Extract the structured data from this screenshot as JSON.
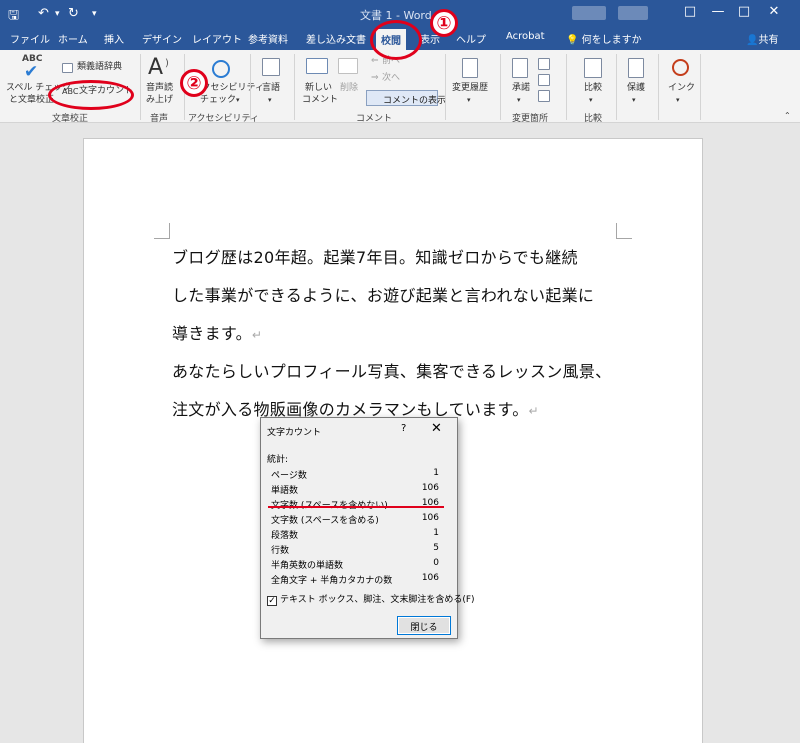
{
  "title_bar": {
    "doc_title": "文書 1  -  Word",
    "window_controls": [
      "□",
      "—",
      "□",
      "✕"
    ]
  },
  "tabs": [
    "ファイル",
    "ホーム",
    "挿入",
    "デザイン",
    "レイアウト",
    "参考資料",
    "差し込み文書",
    "校閲",
    "表示",
    "ヘルプ",
    "Acrobat"
  ],
  "active_tab": "校閲",
  "tell_me": "何をしますか",
  "share": "共有",
  "ribbon": {
    "spell_abc": "ABC",
    "spell_label1": "スペル チェック",
    "spell_label2": "と文章校正",
    "thesaurus": "類義語辞典",
    "word_count": "文字カウント",
    "read_aloud1": "音声読",
    "read_aloud2": "み上げ",
    "access1": "アクセシビリティ",
    "access2": "チェック",
    "language": "言語",
    "new_comment1": "新しい",
    "new_comment2": "コメント",
    "delete": "削除",
    "prev": "前へ",
    "next": "次へ",
    "show_comments": "コメントの表示",
    "track_changes": "変更履歴",
    "accept": "承諾",
    "compare": "比較",
    "protect": "保護",
    "ink": "インク",
    "groups": {
      "proofing": "文章校正",
      "speech": "音声",
      "accessibility": "アクセシビリティ",
      "comments": "コメント",
      "changes": "変更箇所",
      "compare": "比較"
    }
  },
  "document": {
    "lines": [
      "ブログ歴は20年超。起業7年目。知識ゼロからでも継続",
      "した事業ができるように、お遊び起業と言われない起業に",
      "導きます。",
      "あなたらしいプロフィール写真、集客できるレッスン風景、",
      "注文が入る物販画像のカメラマンもしています。"
    ],
    "para_mark": "↵"
  },
  "dialog": {
    "title": "文字カウント",
    "help": "?",
    "close": "✕",
    "stats_label": "統計:",
    "rows": [
      {
        "label": "ページ数",
        "value": "1"
      },
      {
        "label": "単語数",
        "value": "106"
      },
      {
        "label": "文字数 (スペースを含めない)",
        "value": "106"
      },
      {
        "label": "文字数 (スペースを含める)",
        "value": "106"
      },
      {
        "label": "段落数",
        "value": "1"
      },
      {
        "label": "行数",
        "value": "5"
      },
      {
        "label": "半角英数の単語数",
        "value": "0"
      },
      {
        "label": "全角文字 + 半角カタカナの数",
        "value": "106"
      }
    ],
    "checkbox_checked": true,
    "checkbox_label": "テキスト ボックス、脚注、文末脚注を含める(F)",
    "close_button": "閉じる"
  },
  "annotations": {
    "badge1": "①",
    "badge2": "②",
    "color": "#e0001b"
  },
  "colors": {
    "word_blue": "#2b579a",
    "ribbon_bg": "#f3f3f3"
  }
}
